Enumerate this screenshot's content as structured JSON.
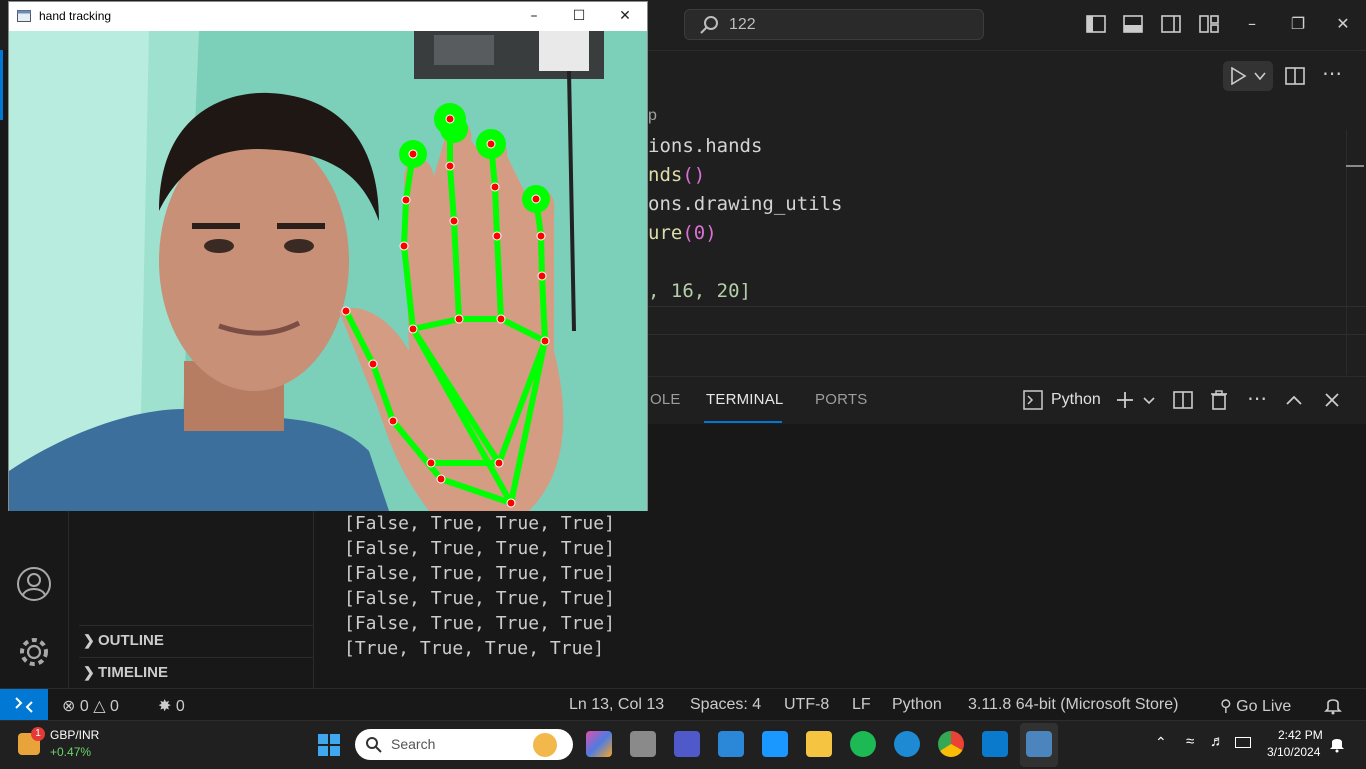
{
  "titlebar": {
    "search_text": "122"
  },
  "editor": {
    "breadcrumb_fragment": "p",
    "code_lines": [
      {
        "pre": "ions.hands",
        "fn": "",
        "post": ""
      },
      {
        "pre": "",
        "fn": "nds",
        "post": "()"
      },
      {
        "pre": "ons.drawing_utils",
        "fn": "",
        "post": ""
      },
      {
        "pre": "",
        "fn": "ure",
        "post": "(0)"
      },
      {
        "pre": "",
        "fn": "",
        "post": ""
      },
      {
        "pre": ", 16, 20]",
        "fn": "",
        "post": ""
      }
    ]
  },
  "panel": {
    "tabs": [
      "OLE",
      "TERMINAL",
      "PORTS"
    ],
    "active_tab": "TERMINAL",
    "shell_label": "Python"
  },
  "terminal": {
    "lines": [
      "[False, True, True, True]",
      "[False, True, True, True]",
      "[False, True, True, True]",
      "[False, True, True, True]",
      "[False, True, True, True]",
      "[True, True, True, True]"
    ]
  },
  "sidebar": {
    "sections": [
      "OUTLINE",
      "TIMELINE"
    ]
  },
  "statusbar": {
    "errors": "0",
    "warnings": "0",
    "ports": "0",
    "position": "Ln 13, Col 13",
    "spaces": "Spaces: 4",
    "encoding": "UTF-8",
    "eol": "LF",
    "language": "Python",
    "interpreter": "3.11.8 64-bit (Microsoft Store)",
    "golive": "Go Live"
  },
  "taskbar": {
    "widget_name": "GBP/INR",
    "widget_value": "+0.47%",
    "widget_badge": "1",
    "search_label": "Search",
    "time": "2:42 PM",
    "date": "3/10/2024"
  },
  "cvwindow": {
    "title": "hand tracking"
  },
  "colors": {
    "accent": "#0078d4",
    "landmark_line": "#00ff00",
    "landmark_dot": "#ff0000",
    "fingertip": "#00ff00"
  },
  "icons": [
    "search-icon",
    "run-icon",
    "split-icon",
    "more-icon",
    "terminal-icon",
    "plus-icon",
    "trash-icon",
    "account-icon",
    "gear-icon",
    "bell-icon",
    "wifi-icon",
    "volume-icon",
    "battery-icon"
  ]
}
